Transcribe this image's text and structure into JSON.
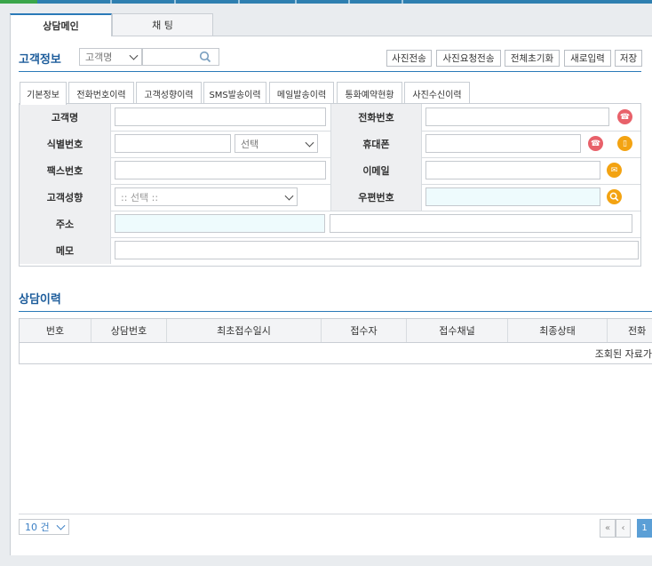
{
  "tabs": {
    "main": "상담메인",
    "chat": "채 팅"
  },
  "customer": {
    "title": "고객정보",
    "search_type": "고객명",
    "search_value": "",
    "buttons": [
      "사진전송",
      "사진요청전송",
      "전체초기화",
      "새로입력",
      "저장"
    ]
  },
  "subtabs": [
    "기본정보",
    "전화번호이력",
    "고객성향이력",
    "SMS발송이력",
    "메일발송이력",
    "통화예약현황",
    "사진수신이력"
  ],
  "form": {
    "name_label": "고객명",
    "phone_label": "전화번호",
    "id_label": "식별번호",
    "id_type": "선택",
    "mobile_label": "휴대폰",
    "fax_label": "팩스번호",
    "email_label": "이메일",
    "tendency_label": "고객성향",
    "tendency_value": ":: 선택 ::",
    "zip_label": "우편번호",
    "addr_label": "주소",
    "memo_label": "메모"
  },
  "history": {
    "title": "상담이력",
    "columns": [
      "번호",
      "상담번호",
      "최초접수일시",
      "접수자",
      "접수채널",
      "최종상태",
      "전화"
    ],
    "empty_text": "조회된 자료가"
  },
  "pager": {
    "page_size": "10 건",
    "first": "«",
    "prev": "‹",
    "current": "1"
  },
  "colors": {
    "accent": "#1c5c9b",
    "tab_border": "#2a7ab8",
    "icon_red": "#e8616a",
    "icon_orange": "#f3a312"
  }
}
